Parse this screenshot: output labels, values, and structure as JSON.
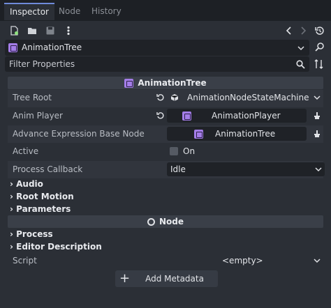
{
  "tabs": [
    {
      "label": "Inspector",
      "active": true
    },
    {
      "label": "Node",
      "active": false
    },
    {
      "label": "History",
      "active": false
    }
  ],
  "toolbar": {
    "new_icon": "new-resource-icon",
    "open_icon": "open-folder-icon",
    "save_icon": "save-icon",
    "more_icon": "more-vertical-icon",
    "back_icon": "chevron-left-icon",
    "forward_icon": "chevron-right-icon",
    "history_icon": "history-icon"
  },
  "object_selector": {
    "value": "AnimationTree"
  },
  "filter": {
    "placeholder": "Filter Properties"
  },
  "sections": {
    "animation_tree": "AnimationTree",
    "node": "Node"
  },
  "properties": {
    "tree_root": {
      "label": "Tree Root",
      "value": "AnimationNodeStateMachine"
    },
    "anim_player": {
      "label": "Anim Player",
      "value": "AnimationPlayer"
    },
    "advance_expr": {
      "label": "Advance Expression Base Node",
      "value": "AnimationTree"
    },
    "active": {
      "label": "Active",
      "value": "On"
    },
    "process_callback": {
      "label": "Process Callback",
      "value": "Idle"
    }
  },
  "groups": {
    "audio": "Audio",
    "root_motion": "Root Motion",
    "parameters": "Parameters",
    "process": "Process",
    "editor_description": "Editor Description"
  },
  "script": {
    "label": "Script",
    "value": "<empty>"
  },
  "add_metadata": {
    "label": "Add Metadata"
  }
}
